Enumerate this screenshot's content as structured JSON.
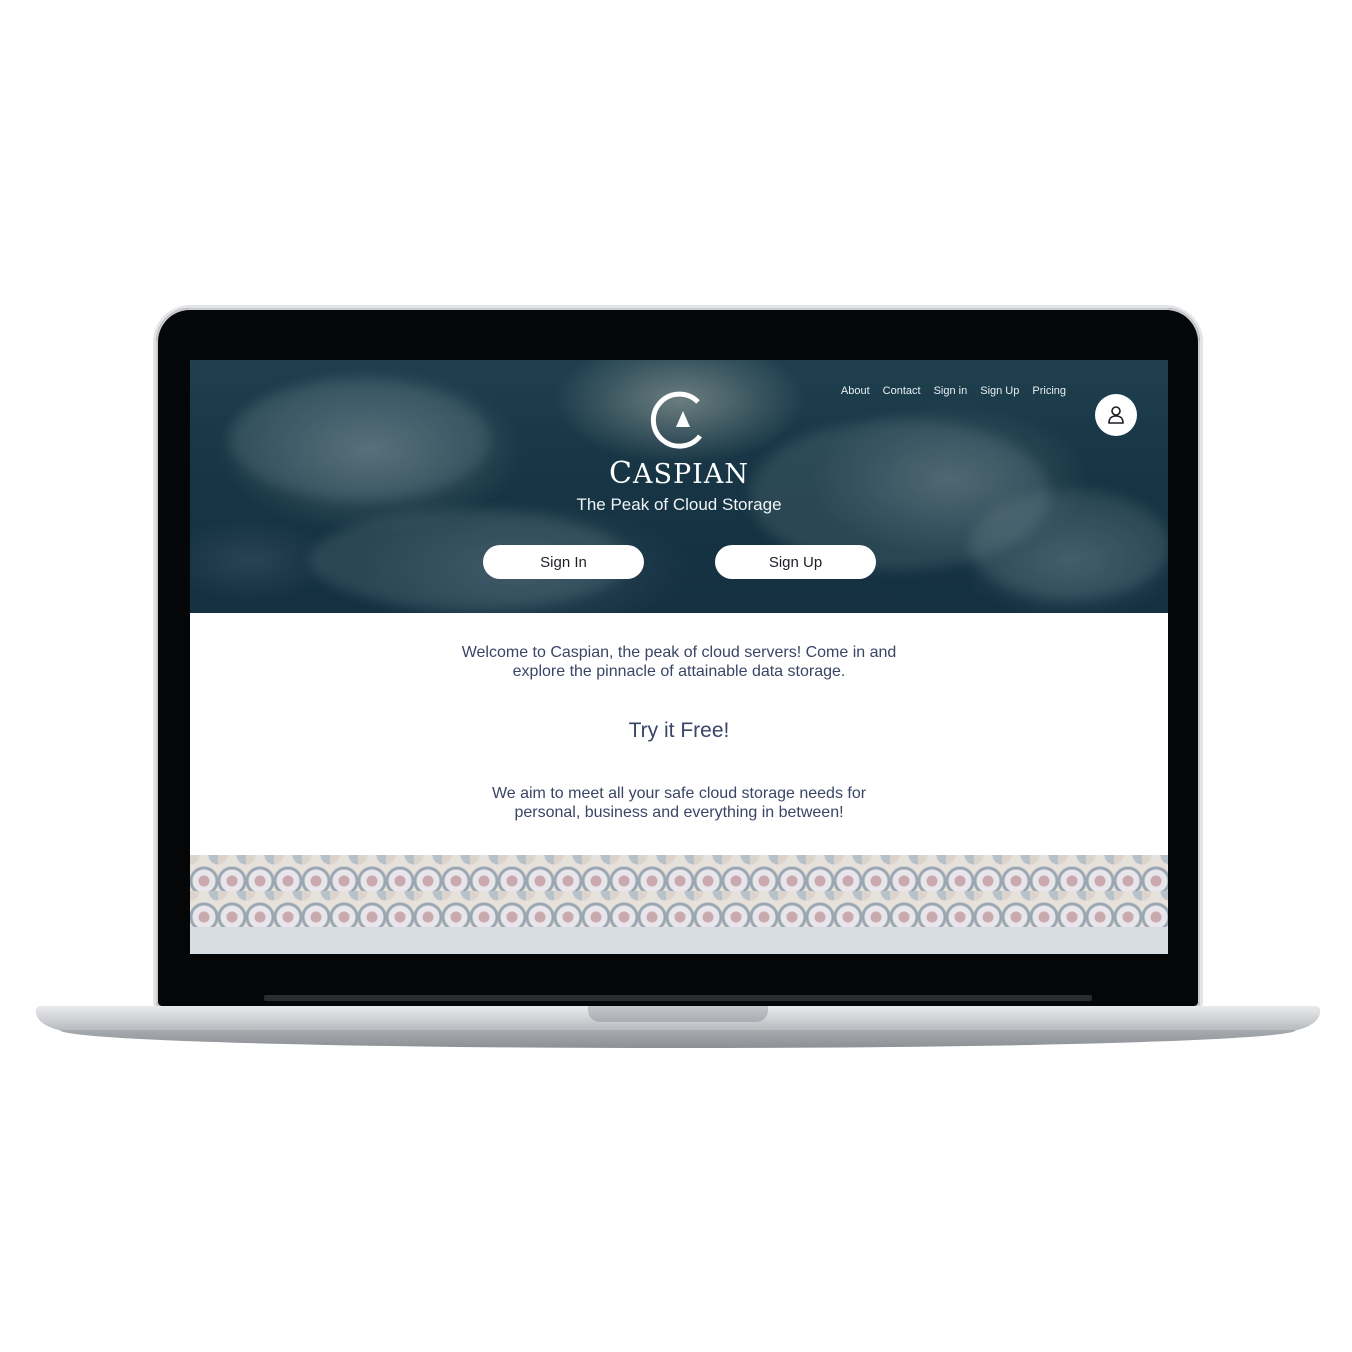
{
  "nav": {
    "items": [
      "About",
      "Contact",
      "Sign in",
      "Sign Up",
      "Pricing"
    ]
  },
  "brand": {
    "initial": "C",
    "rest": "ASPIAN",
    "tagline": "The Peak of Cloud Storage"
  },
  "hero_buttons": {
    "sign_in": "Sign In",
    "sign_up": "Sign Up"
  },
  "content": {
    "welcome": "Welcome to Caspian, the peak of cloud servers! Come in and explore the pinnacle of attainable data storage.",
    "try_free": "Try it Free!",
    "aim": "We aim to meet all your safe cloud storage needs for personal, business and everything in between!"
  },
  "icons": {
    "user": "user-icon",
    "logo": "caspian-logo-icon"
  },
  "colors": {
    "hero_bg": "#173544",
    "text": "#3a4566",
    "button_bg": "#ffffff",
    "footer_strip": "#d6dde3"
  }
}
